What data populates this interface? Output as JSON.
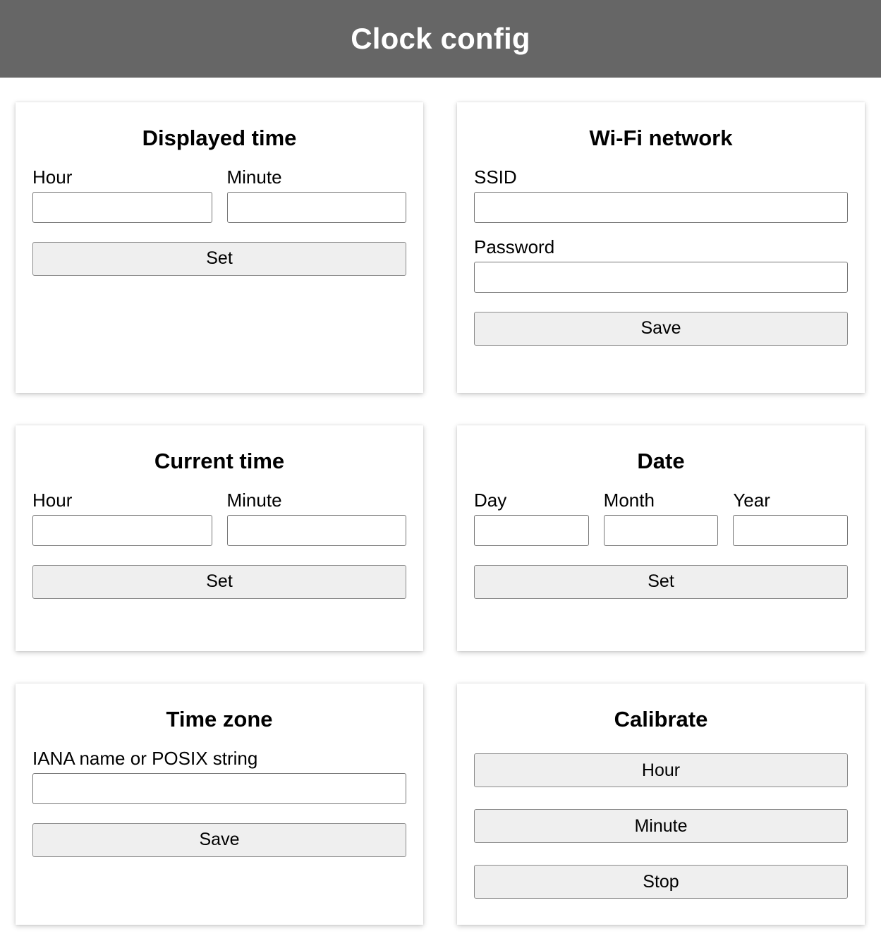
{
  "header": {
    "title": "Clock config"
  },
  "cards": {
    "displayed_time": {
      "title": "Displayed time",
      "hour_label": "Hour",
      "hour_value": "",
      "minute_label": "Minute",
      "minute_value": "",
      "set_button": "Set"
    },
    "wifi_network": {
      "title": "Wi-Fi network",
      "ssid_label": "SSID",
      "ssid_value": "",
      "password_label": "Password",
      "password_value": "",
      "save_button": "Save"
    },
    "current_time": {
      "title": "Current time",
      "hour_label": "Hour",
      "hour_value": "",
      "minute_label": "Minute",
      "minute_value": "",
      "set_button": "Set"
    },
    "date": {
      "title": "Date",
      "day_label": "Day",
      "day_value": "",
      "month_label": "Month",
      "month_value": "",
      "year_label": "Year",
      "year_value": "",
      "set_button": "Set"
    },
    "time_zone": {
      "title": "Time zone",
      "tz_label": "IANA name or POSIX string",
      "tz_value": "",
      "save_button": "Save"
    },
    "calibrate": {
      "title": "Calibrate",
      "hour_button": "Hour",
      "minute_button": "Minute",
      "stop_button": "Stop"
    }
  },
  "colors": {
    "header_background": "#666666",
    "header_text": "#ffffff",
    "page_background": "#ffffff",
    "card_background": "#ffffff",
    "button_background": "#efefef",
    "button_border": "#8a8a8a",
    "input_border": "#767676",
    "text": "#000000"
  }
}
